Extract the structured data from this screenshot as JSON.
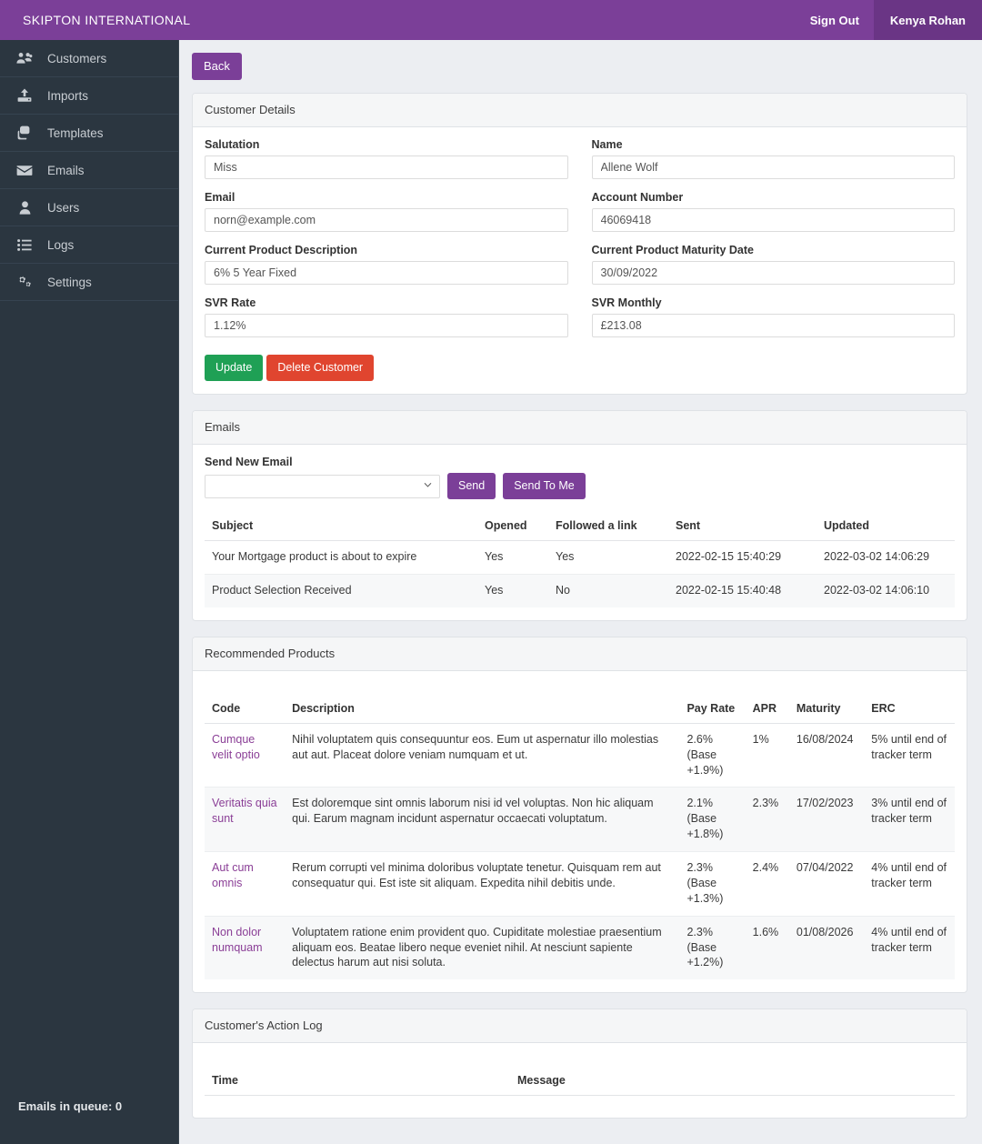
{
  "topbar": {
    "brand": "SKIPTON INTERNATIONAL",
    "sign_out": "Sign Out",
    "user": "Kenya Rohan",
    "bg_color": "#7b3f98",
    "user_bg_color": "#6a3585"
  },
  "sidebar": {
    "bg_color": "#2b3640",
    "items": [
      {
        "label": "Customers",
        "icon": "users-group-icon"
      },
      {
        "label": "Imports",
        "icon": "upload-icon"
      },
      {
        "label": "Templates",
        "icon": "copy-icon"
      },
      {
        "label": "Emails",
        "icon": "envelope-icon"
      },
      {
        "label": "Users",
        "icon": "user-icon"
      },
      {
        "label": "Logs",
        "icon": "list-icon"
      },
      {
        "label": "Settings",
        "icon": "cogs-icon"
      }
    ],
    "queue_status": "Emails in queue: 0"
  },
  "main": {
    "back_label": "Back"
  },
  "customer_details": {
    "title": "Customer Details",
    "fields": [
      {
        "label": "Salutation",
        "value": "Miss",
        "name": "salutation-field"
      },
      {
        "label": "Name",
        "value": "Allene Wolf",
        "name": "name-field"
      },
      {
        "label": "Email",
        "value": "norn@example.com",
        "name": "email-field"
      },
      {
        "label": "Account Number",
        "value": "46069418",
        "name": "account-number-field"
      },
      {
        "label": "Current Product Description",
        "value": "6% 5 Year Fixed",
        "name": "current-product-description-field"
      },
      {
        "label": "Current Product Maturity Date",
        "value": "30/09/2022",
        "name": "current-product-maturity-date-field"
      },
      {
        "label": "SVR Rate",
        "value": "1.12%",
        "name": "svr-rate-field"
      },
      {
        "label": "SVR Monthly",
        "value": "£213.08",
        "name": "svr-monthly-field"
      }
    ],
    "update_label": "Update",
    "delete_label": "Delete Customer",
    "update_color": "#1fa055",
    "delete_color": "#e0452f"
  },
  "emails": {
    "title": "Emails",
    "send_new_email_label": "Send New Email",
    "select_value": "",
    "select_options": [
      ""
    ],
    "send_label": "Send",
    "send_to_me_label": "Send To Me",
    "columns": [
      "Subject",
      "Opened",
      "Followed a link",
      "Sent",
      "Updated"
    ],
    "rows": [
      {
        "subject": "Your Mortgage product is about to expire",
        "opened": "Yes",
        "followed_a_link": "Yes",
        "sent": "2022-02-15 15:40:29",
        "updated": "2022-03-02 14:06:29"
      },
      {
        "subject": "Product Selection Received",
        "opened": "Yes",
        "followed_a_link": "No",
        "sent": "2022-02-15 15:40:48",
        "updated": "2022-03-02 14:06:10"
      }
    ]
  },
  "recommended_products": {
    "title": "Recommended Products",
    "columns": [
      "Code",
      "Description",
      "Pay Rate",
      "APR",
      "Maturity",
      "ERC"
    ],
    "link_color": "#8a3e96",
    "rows": [
      {
        "code": "Cumque velit optio",
        "description": "Nihil voluptatem quis consequuntur eos. Eum ut aspernatur illo molestias aut aut. Placeat dolore veniam numquam et ut.",
        "pay_rate": "2.6% (Base +1.9%)",
        "apr": "1%",
        "maturity": "16/08/2024",
        "erc": "5% until end of tracker term"
      },
      {
        "code": "Veritatis quia sunt",
        "description": "Est doloremque sint omnis laborum nisi id vel voluptas. Non hic aliquam qui. Earum magnam incidunt aspernatur occaecati voluptatum.",
        "pay_rate": "2.1% (Base +1.8%)",
        "apr": "2.3%",
        "maturity": "17/02/2023",
        "erc": "3% until end of tracker term"
      },
      {
        "code": "Aut cum omnis",
        "description": "Rerum corrupti vel minima doloribus voluptate tenetur. Quisquam rem aut consequatur qui. Est iste sit aliquam. Expedita nihil debitis unde.",
        "pay_rate": "2.3% (Base +1.3%)",
        "apr": "2.4%",
        "maturity": "07/04/2022",
        "erc": "4% until end of tracker term"
      },
      {
        "code": "Non dolor numquam",
        "description": "Voluptatem ratione enim provident quo. Cupiditate molestiae praesentium aliquam eos. Beatae libero neque eveniet nihil. At nesciunt sapiente delectus harum aut nisi soluta.",
        "pay_rate": "2.3% (Base +1.2%)",
        "apr": "1.6%",
        "maturity": "01/08/2026",
        "erc": "4% until end of tracker term"
      }
    ]
  },
  "action_log": {
    "title": "Customer's Action Log",
    "columns": [
      "Time",
      "Message"
    ],
    "rows": []
  }
}
